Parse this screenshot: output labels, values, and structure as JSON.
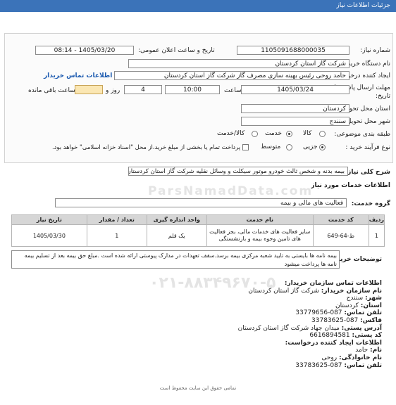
{
  "header": {
    "title": "جزئیات اطلاعات نیاز"
  },
  "watermark": {
    "site": "ParsNamadData.com",
    "phone": "۰۲۱-۸۸۳۴۹۶۷۰-۵"
  },
  "form": {
    "need_number_label": "شماره نیاز:",
    "need_number": "1105091688000035",
    "announce_label": "تاریخ و ساعت اعلان عمومی:",
    "announce_value": "1405/03/20 - 08:14",
    "buyer_label": "نام دستگاه خریدار:",
    "buyer_value": "شرکت گاز استان کردستان",
    "creator_label": "ایجاد کننده درخواست:",
    "creator_value": "حامد روحی رئیس بهینه سازی مصرف گاز شرکت گاز استان کردستان",
    "contact_link": "اطلاعات تماس خریدار",
    "deadline_label_1": "مهلت ارسال پاسخ: تا",
    "deadline_label_2": "تاریخ:",
    "deadline_date": "1405/03/24",
    "time_label": "ساعت",
    "deadline_time": "10:00",
    "days_value": "4",
    "days_label": "روز و",
    "remaining_label": "ساعت باقی مانده",
    "province_label": "استان محل تحویل:",
    "province_value": "کردستان",
    "city_label": "شهر محل تحویل:",
    "city_value": "سنندج",
    "category_label": "طبقه بندی موضوعی:",
    "category_options": [
      "کالا",
      "خدمت",
      "کالا/خدمت"
    ],
    "category_selected": "خدمت",
    "process_label": "نوع فرآیند خرید :",
    "process_options": [
      "جزیی",
      "متوسط"
    ],
    "process_selected": "جزیی",
    "payment_note": "پرداخت تمام یا بخشی از مبلغ خرید،از محل \"اسناد خزانه اسلامی\" خواهد بود."
  },
  "summary": {
    "label": "شرح کلی نیاز:",
    "value": "بیمه بدنه و شخص ثالث خودرو موتور سیکلت و وسائل نقلیه شرکت گاز استان کردستان"
  },
  "services": {
    "title": "اطلاعات خدمات مورد نیاز",
    "group_label": "گروه خدمت:",
    "group_value": "فعالیت  های مالی و بیمه",
    "columns": [
      "ردیف",
      "کد خدمت",
      "نام خدمت",
      "واحد اندازه گیری",
      "تعداد / مقدار",
      "تاریخ نیاز"
    ],
    "rows": [
      {
        "row": "1",
        "code": "ط-64-649",
        "name": "سایر فعالیت های خدمات مالی، بجز فعالیت های تامین وجوه بیمه و بازنشستگی",
        "unit": "یک قلم",
        "qty": "1",
        "date": "1405/03/30"
      }
    ],
    "notes_label": "توضیحات خریدار:",
    "notes_value": "بیمه نامه ها بایستی به تایید شعبه مرکزی بیمه برسد.سقف تعهدات در مدارک پیوستی ارائه شده است .مبلغ حق بیمه بعد از تسلیم بیمه نامه ها پرداخت میشود"
  },
  "contact": {
    "title": "اطلاعات تماس سازمان خریدار:",
    "lines": [
      {
        "label": "نام سازمان خریدار:",
        "value": "شرکت گاز استان کردستان"
      },
      {
        "label": "شهر:",
        "value": "سنندج"
      },
      {
        "label": "استان:",
        "value": "کردستان"
      },
      {
        "label": "تلفن تماس:",
        "value": "087-33779656"
      },
      {
        "label": "فاکس:",
        "value": "087-33783625"
      },
      {
        "label": "آدرس پستی:",
        "value": "میدان جهاد شرکت گاز استان کردستان"
      },
      {
        "label": "کد پستی:",
        "value": "6616894581"
      },
      {
        "label": "اطلاعات ایجاد کننده درخواست:",
        "value": ""
      },
      {
        "label": "نام:",
        "value": "حامد"
      },
      {
        "label": "نام خانوادگی:",
        "value": "روحی"
      },
      {
        "label": "تلفن تماس:",
        "value": "087-33783625"
      }
    ]
  },
  "footer": {
    "text": "تمامی حقوق این سایت محفوظ است"
  }
}
